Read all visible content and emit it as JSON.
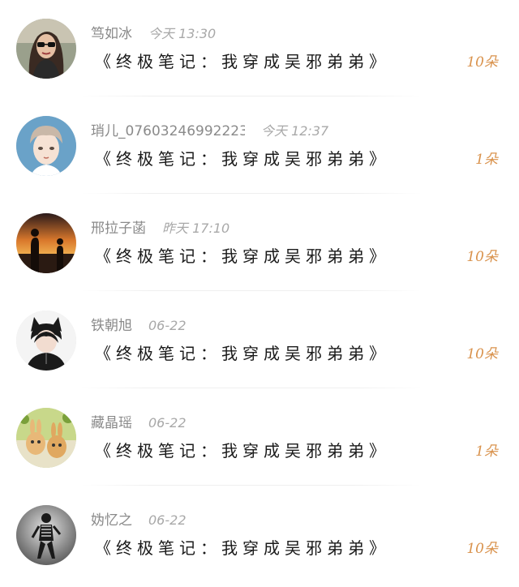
{
  "messages": [
    {
      "name": "笃如冰",
      "time": "今天 13:30",
      "text": "《终极笔记：我穿成吴邪弟弟》",
      "count": "10朵",
      "avatar": "woman-sunglasses-avatar"
    },
    {
      "name": "琑儿_07603246992223...",
      "time": "今天 12:37",
      "text": "《终极笔记：我穿成吴邪弟弟》",
      "count": "1朵",
      "avatar": "anime-boy-avatar"
    },
    {
      "name": "邢拉子菡",
      "time": "昨天 17:10",
      "text": "《终极笔记：我穿成吴邪弟弟》",
      "count": "10朵",
      "avatar": "sunset-silhouette-avatar"
    },
    {
      "name": "铁朝旭",
      "time": "06-22",
      "text": "《终极笔记：我穿成吴邪弟弟》",
      "count": "10朵",
      "avatar": "cat-ear-boy-avatar"
    },
    {
      "name": "藏晶瑶",
      "time": "06-22",
      "text": "《终极笔记：我穿成吴邪弟弟》",
      "count": "1朵",
      "avatar": "bunny-cartoon-avatar"
    },
    {
      "name": "妫忆之",
      "time": "06-22",
      "text": "《终极笔记：我穿成吴邪弟弟》",
      "count": "10朵",
      "avatar": "bw-figure-avatar"
    }
  ],
  "colors": {
    "count": "#d9924c",
    "meta": "#8a8a8a",
    "message": "#1a1a1a"
  }
}
